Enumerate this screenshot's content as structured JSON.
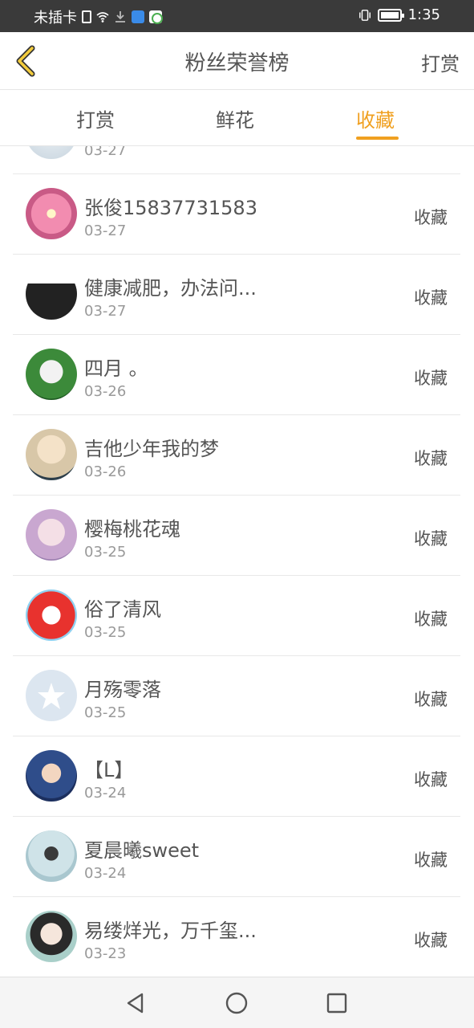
{
  "status_bar": {
    "carrier": "未插卡",
    "time": "1:35"
  },
  "header": {
    "title": "粉丝荣誉榜",
    "right_action": "打赏"
  },
  "tabs": [
    {
      "label": "打赏",
      "active": false
    },
    {
      "label": "鲜花",
      "active": false
    },
    {
      "label": "收藏",
      "active": true
    }
  ],
  "colors": {
    "accent": "#f0a020"
  },
  "list": {
    "partial_top_date": "03-27",
    "rows": [
      {
        "name": "张俊15837731583",
        "date": "03-27",
        "action": "收藏"
      },
      {
        "name": "健康减肥，办法问...",
        "date": "03-27",
        "action": "收藏"
      },
      {
        "name": "四月 。",
        "date": "03-26",
        "action": "收藏"
      },
      {
        "name": "吉他少年我的梦",
        "date": "03-26",
        "action": "收藏"
      },
      {
        "name": "樱梅桃花魂",
        "date": "03-25",
        "action": "收藏"
      },
      {
        "name": "俗了清风",
        "date": "03-25",
        "action": "收藏"
      },
      {
        "name": "月殇零落",
        "date": "03-25",
        "action": "收藏"
      },
      {
        "name": "【L】",
        "date": "03-24",
        "action": "收藏"
      },
      {
        "name": "夏晨曦sweet",
        "date": "03-24",
        "action": "收藏"
      },
      {
        "name": "易缕烊光，万千玺...",
        "date": "03-23",
        "action": "收藏"
      }
    ]
  }
}
